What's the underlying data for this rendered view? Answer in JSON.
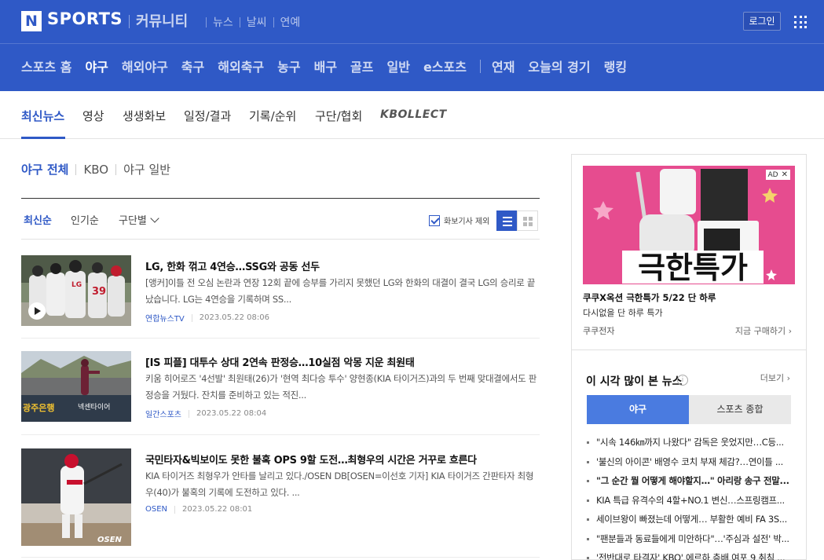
{
  "header": {
    "logo_letter": "N",
    "logo_text": "SPORTS",
    "community": "커뮤니티",
    "quicklinks": [
      "뉴스",
      "날씨",
      "연예"
    ],
    "login": "로그인"
  },
  "main_nav": {
    "items": [
      "스포츠 홈",
      "야구",
      "해외야구",
      "축구",
      "해외축구",
      "농구",
      "배구",
      "골프",
      "일반",
      "e스포츠"
    ],
    "extra": [
      "연재",
      "오늘의 경기",
      "랭킹"
    ],
    "active": "야구"
  },
  "sub_nav": {
    "items": [
      "최신뉴스",
      "영상",
      "생생화보",
      "일정/결과",
      "기록/순위",
      "구단/협회"
    ],
    "brand": "KBOLLECT",
    "active": "최신뉴스"
  },
  "category": {
    "items": [
      "야구 전체",
      "KBO",
      "야구 일반"
    ],
    "active": "야구 전체"
  },
  "sort": {
    "latest": "최신순",
    "popular": "인기순",
    "team": "구단별",
    "exclude_photo": "화보기사 제외"
  },
  "articles": [
    {
      "title": "LG, 한화 꺾고 4연승…SSG와 공동 선두",
      "desc": "[앵커]이틀 전 오심 논란과 연장 12회 끝에 승부를 가리지 못했던 LG와 한화의 대결이 결국 LG의 승리로 끝났습니다. LG는 4연승을 기록하며 SS...",
      "press": "연합뉴스TV",
      "time": "2023.05.22 08:06"
    },
    {
      "title": "[IS 피플] 대투수 상대 2연속 판정승…10실점 악몽 지운 최원태",
      "desc": "키움 히어로즈 '4선발' 최원태(26)가 '현역 최다승 투수' 양현종(KIA 타이거즈)과의 두 번째 맞대결에서도 판정승을 거뒀다. 잔치를 준비하고 있는 적진...",
      "press": "일간스포츠",
      "time": "2023.05.22 08:04"
    },
    {
      "title": "국민타자&빅보이도 못한 불혹 OPS 9할 도전…최형우의 시간은 거꾸로 흐른다",
      "desc": "KIA 타이거즈 최형우가 안타를 날리고 있다./OSEN DB[OSEN=이선호 기자] KIA 타이거즈 간판타자 최형우(40)가 불혹의 기록에 도전하고 있다. ...",
      "press": "OSEN",
      "time": "2023.05.22 08:01"
    }
  ],
  "ad": {
    "badge": "AD",
    "banner_text": "극한특가",
    "title": "쿠쿠X옥션 극한특가 5/22 단 하루",
    "subtitle": "다시없을 단 하루 특가",
    "advertiser": "쿠쿠전자",
    "cta": "지금 구매하기 ›"
  },
  "popular": {
    "title": "이 시각 많이 본 뉴스",
    "more": "더보기 ›",
    "tabs": [
      "야구",
      "스포츠 종합"
    ],
    "items": [
      "\"시속 146㎞까지 나왔다\" 감독은 웃었지만…C등...",
      "'불신의 아이콘' 배영수 코치 부재 체감?…연이틀 ...",
      "\"그 순간 뭘 어떻게 해야할지…\" 아리랑 송구 전말...",
      "KIA 특급 유격수의 4할+NO.1 변신…스프링캠프...",
      "세이브왕이 빠졌는데 어떻게… 부활한 예비 FA 3S...",
      "\"팬분들과 동료들에게 미안하다\"…'주심과 설전' 박...",
      "'전반대로 타격자' KBO' 에르하 층배 여포 9 취침 ..."
    ]
  },
  "colors": {
    "brand_blue": "#2f59c6",
    "tab_blue": "#4a7be0",
    "ad_pink": "#e64c8f"
  }
}
